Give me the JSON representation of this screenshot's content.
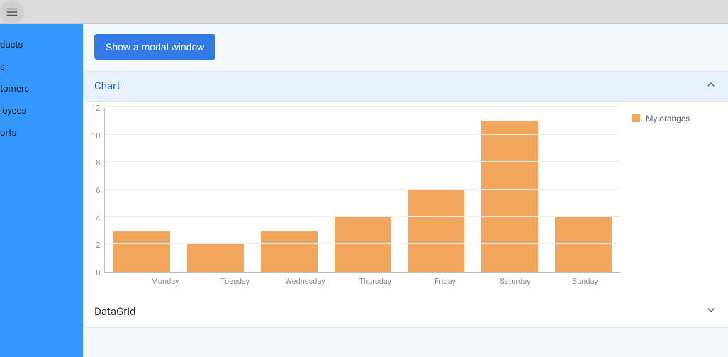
{
  "sidebar": {
    "items": [
      {
        "label": "ducts"
      },
      {
        "label": "s"
      },
      {
        "label": "tomers"
      },
      {
        "label": "loyees"
      },
      {
        "label": "orts"
      }
    ]
  },
  "actions": {
    "show_modal_label": "Show a modal window"
  },
  "accordions": {
    "chart": {
      "title": "Chart"
    },
    "datagrid": {
      "title": "DataGrid"
    }
  },
  "chart_data": {
    "type": "bar",
    "title": "",
    "xlabel": "",
    "ylabel": "",
    "ylim": [
      0,
      12
    ],
    "yticks": [
      0,
      2,
      4,
      6,
      8,
      10,
      12
    ],
    "categories": [
      "Monday",
      "Tuesday",
      "Wednesday",
      "Thursday",
      "Friday",
      "Saturday",
      "Sunday"
    ],
    "series": [
      {
        "name": "My oranges",
        "color": "#f2a55c",
        "values": [
          3,
          2,
          3,
          4,
          6,
          11,
          4
        ]
      }
    ]
  }
}
